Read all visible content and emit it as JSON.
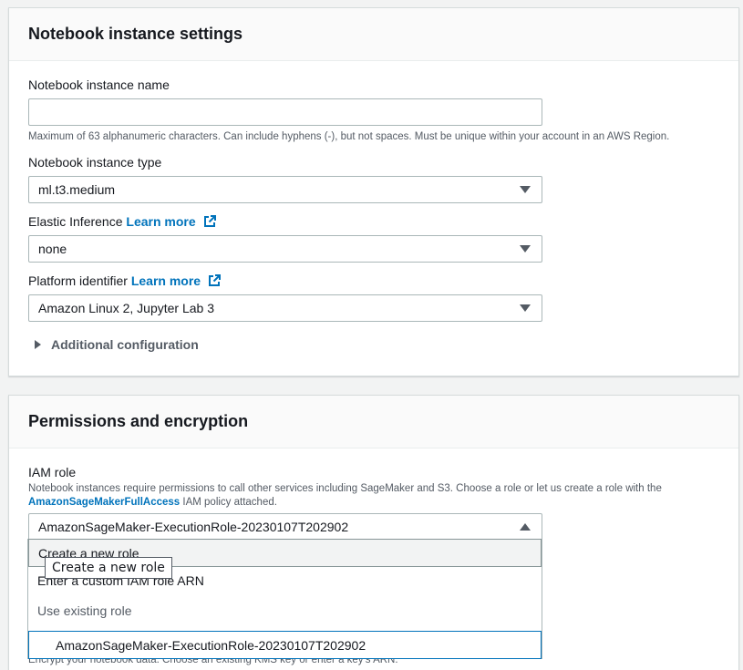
{
  "notebook_settings": {
    "title": "Notebook instance settings",
    "name_label": "Notebook instance name",
    "name_value": "",
    "name_hint": "Maximum of 63 alphanumeric characters. Can include hyphens (-), but not spaces. Must be unique within your account in an AWS Region.",
    "type_label": "Notebook instance type",
    "type_value": "ml.t3.medium",
    "elastic_label": "Elastic Inference",
    "elastic_link": "Learn more",
    "elastic_value": "none",
    "platform_label": "Platform identifier",
    "platform_link": "Learn more",
    "platform_value": "Amazon Linux 2, Jupyter Lab 3",
    "additional_config": "Additional configuration"
  },
  "permissions": {
    "title": "Permissions and encryption",
    "iam_label": "IAM role",
    "iam_desc_1": "Notebook instances require permissions to call other services including SageMaker and S3. Choose a role or let us create a role with the",
    "iam_policy_link": "AmazonSageMakerFullAccess",
    "iam_desc_2": " IAM policy attached.",
    "iam_value": "AmazonSageMaker-ExecutionRole-20230107T202902",
    "dropdown": {
      "create_new": "Create a new role",
      "custom_arn": "Enter a custom IAM role ARN",
      "group_label": "Use existing role",
      "existing_role": "AmazonSageMaker-ExecutionRole-20230107T202902"
    },
    "tooltip": "Create a new role",
    "encrypt_hint": "Encrypt your notebook data. Choose an existing KMS key or enter a key's ARN."
  },
  "colors": {
    "link": "#0073bb",
    "border": "#aab7b8",
    "background": "#f2f3f3"
  },
  "icons": {
    "external": "external-link-icon",
    "expand": "caret-right-icon",
    "dropdown": "caret-down-icon"
  }
}
